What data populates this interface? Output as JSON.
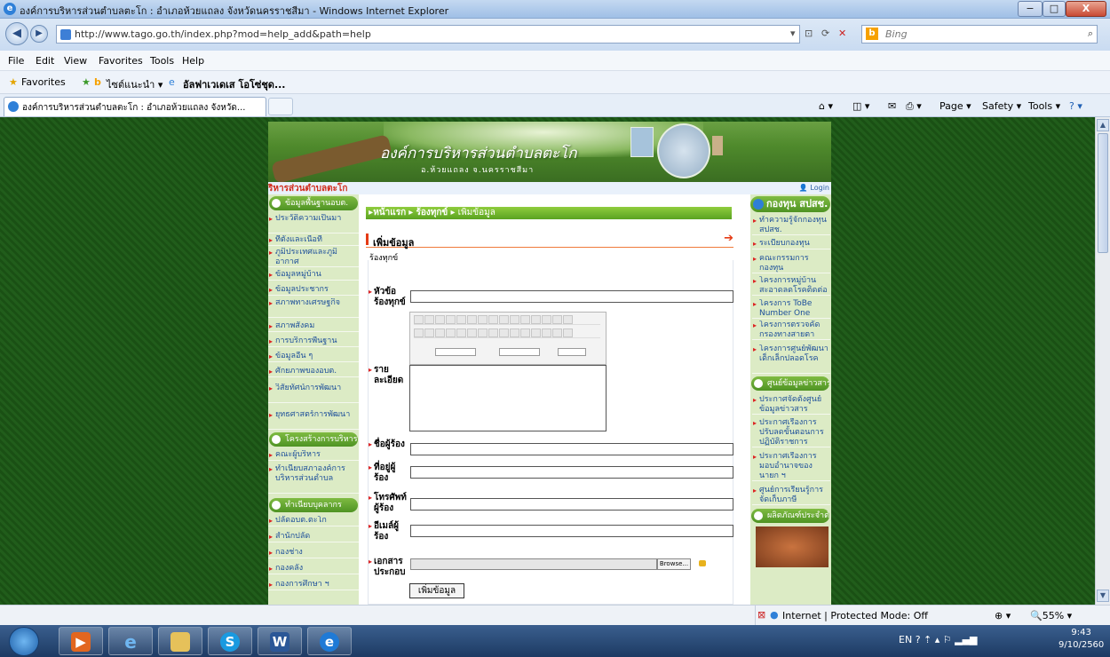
{
  "window": {
    "title": "องค์การบริหารส่วนตำบลตะโก : อำเภอห้วยแถลง จังหวัดนครราชสีมา - Windows Internet Explorer",
    "min": "−",
    "max": "□",
    "close": "X"
  },
  "address_bar": {
    "url": "http://www.tago.go.th/index.php?mod=help_add&path=help",
    "search_placeholder": "Bing"
  },
  "menu": [
    "File",
    "Edit",
    "View",
    "Favorites",
    "Tools",
    "Help"
  ],
  "favorites_bar": {
    "favorites_label": "Favorites",
    "item1": "ไซต์แนะนำ ▾",
    "item2": "อัลฟาเวเดเส โอโซ่ชุด..."
  },
  "tab": {
    "label": "องค์การบริหารส่วนตำบลตะโก : อำเภอห้วยแถลง จังหวัด..."
  },
  "commands": [
    "Page ▾",
    "Safety ▾",
    "Tools ▾"
  ],
  "site": {
    "banner_name": "องค์การบริหารส่วนตำบลตะโก",
    "banner_sub": "อ.ห้วยแถลง จ.นครราชสีมา",
    "strip_text": "ริหารส่วนตำบลตะโก",
    "login": "Login"
  },
  "left_menu": {
    "header1": "ข้อมูลพื้นฐานอบต.",
    "items1": [
      "ประวัติความเป็นมา",
      "ที่ตั้งและเนื้อที่",
      "ภูมิประเทศและภูมิอากาศ",
      "ข้อมูลหมู่บ้าน",
      "ข้อมูลประชากร",
      "สภาพทางเศรษฐกิจ",
      "สภาพสังคม",
      "การบริการพื้นฐาน",
      "ข้อมูลอื่น ๆ",
      "ศักยภาพของอบต.",
      "วิสัยทัศน์การพัฒนา",
      "ยุทธศาสตร์การพัฒนา"
    ],
    "header2": "โครงสร้างการบริหาร",
    "items2": [
      "คณะผู้บริหาร",
      "ทำเนียบสภาองค์การบริหารส่วนตำบล"
    ],
    "header3": "ทำเนียบบุคลากร",
    "items3": [
      "ปลัดอบต.ตะโก",
      "สำนักปลัด",
      "กองช่าง",
      "กองคลัง",
      "กองการศึกษา ฯ"
    ]
  },
  "right_menu": {
    "header1": "กองทุน สปสช.",
    "items1": [
      "ทำความรู้จักกองทุน สปสช.",
      "ระเบียบกองทุน",
      "คณะกรรมการกองทุน",
      "โครงการหมู่บ้านสะอาดลดโรคติดต่อ",
      "โครงการ ToBe Number One",
      "โครงการตรวจคัดกรองทางสายตา",
      "โครงการศูนย์พัฒนาเด็กเล็กปลอดโรค"
    ],
    "header2": "ศูนย์ข้อมูลข่าวสาร",
    "items2": [
      "ประกาศจัดตั้งศูนย์ข้อมูลข่าวสาร",
      "ประกาศเรื่องการปรับลดขั้นตอนการปฏิบัติราชการ",
      "ประกาศเรื่องการมอบอำนาจของนายก ฯ",
      "ศูนย์การเรียนรู้การจัดเก็บภาษี"
    ],
    "header3": "ผลิตภัณฑ์ประจำตำบล"
  },
  "main": {
    "breadcrumb": [
      "หน้าแรก",
      "ร้องทุกข์",
      "เพิ่มข้อมูล"
    ],
    "section_title": "เพิ่มข้อมูล",
    "subtitle": "ร้องทุกข์",
    "label_topic": "หัวข้อร้องทุกข์",
    "label_detail": "รายละเอียด",
    "label_name": "ชื่อผู้ร้อง",
    "label_address": "ที่อยู่ผู้ร้อง",
    "label_phone": "โทรศัพท์ผู้ร้อง",
    "label_email": "อีเมล์ผู้ร้อง",
    "label_attach": "เอกสารประกอบ",
    "browse": "Browse...",
    "submit": "เพิ่มข้อมูล"
  },
  "status": {
    "zone": "Internet | Protected Mode: Off",
    "zoom": "55%"
  },
  "taskbar": {
    "lang": "EN",
    "time": "9:43",
    "date": "9/10/2560"
  }
}
